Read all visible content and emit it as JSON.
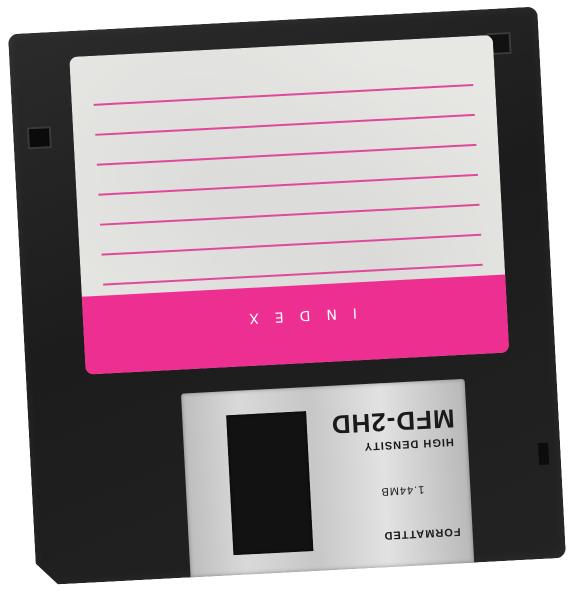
{
  "label": {
    "index_text": "INDEX",
    "line_count": 7,
    "line_color": "#e0489a",
    "band_color": "#ee2f92"
  },
  "shutter": {
    "model": "MFD-2HD",
    "density": "HIGH DENSITY",
    "capacity": "1.44MB",
    "status": "FORMATTED"
  },
  "colors": {
    "disk_body": "#1f1f1f",
    "label_background": "#e7e7e4",
    "shutter_metal": "#cfcfcf"
  }
}
